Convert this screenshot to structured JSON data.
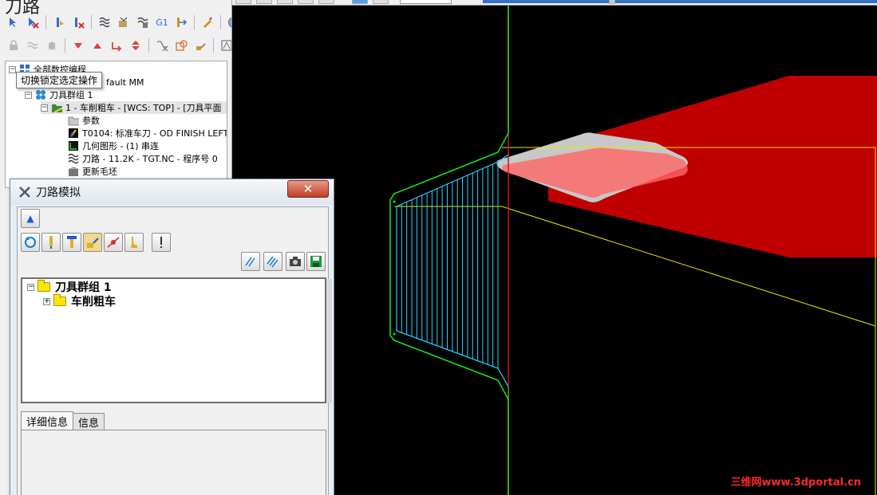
{
  "panel": {
    "title": "刀路"
  },
  "op_tree": {
    "items": [
      {
        "label": "全部数控编程",
        "level": 0,
        "expander": "−",
        "icon": "machine-icon"
      },
      {
        "label": "fault MM",
        "level": 1,
        "expander": "",
        "icon": ""
      },
      {
        "label": "刀具群组 1",
        "level": 1,
        "expander": "−",
        "icon": "tool-group-icon"
      },
      {
        "label": "1 - 车削粗车 - [WCS: TOP] - [刀具平面",
        "level": 2,
        "expander": "−",
        "icon": "operation-folder-icon",
        "selected": true
      },
      {
        "label": "参数",
        "level": 3,
        "expander": "",
        "icon": "parameters-icon"
      },
      {
        "label": "T0104: 标准车刀 - OD FINISH LEFT",
        "level": 3,
        "expander": "",
        "icon": "lathe-tool-icon"
      },
      {
        "label": "几何图形 - (1) 串连",
        "level": 3,
        "expander": "",
        "icon": "geometry-icon"
      },
      {
        "label": "刀路 - 11.2K - TGT.NC - 程序号 0",
        "level": 3,
        "expander": "",
        "icon": "toolpath-icon"
      },
      {
        "label": "更新毛坯",
        "level": 3,
        "expander": "",
        "icon": "stock-update-icon"
      }
    ],
    "tooltip": "切换锁定选定操作"
  },
  "sim_dialog": {
    "title": "刀路模拟",
    "close_glyph": "✕",
    "up_glyph": "▲",
    "tree": [
      {
        "label": "刀具群组 1",
        "expander": "−"
      },
      {
        "label": "车削粗车",
        "expander": "+"
      }
    ],
    "tabs": [
      {
        "label": "详细信息",
        "active": true
      },
      {
        "label": "信息",
        "active": false
      }
    ]
  },
  "watermark": "三维网www.3dportal.cn",
  "colors": {
    "viewport_bg": "#000000",
    "tool_red": "#c00000",
    "insert_gray": "#c8c8c8",
    "toolpath_cyan": "#28d2ff",
    "chain_green": "#18e818",
    "stock_yellow": "#e8e800",
    "axis_red": "#c81414"
  }
}
